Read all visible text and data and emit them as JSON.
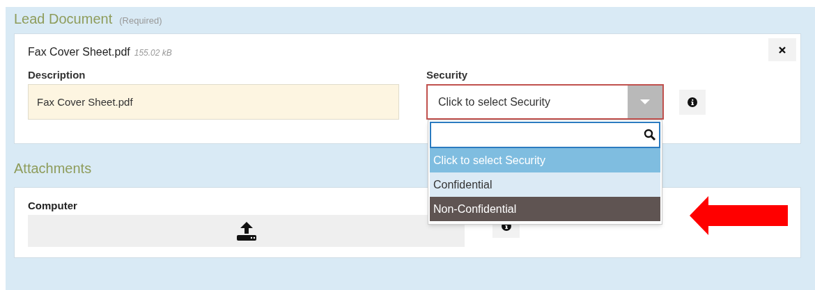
{
  "lead_document": {
    "title": "Lead Document",
    "note": "(Required)",
    "file": {
      "name": "Fax Cover Sheet.pdf",
      "size": "155.02 kB"
    },
    "description": {
      "label": "Description",
      "value": "Fax Cover Sheet.pdf"
    },
    "security": {
      "label": "Security",
      "value": "Click to select Security",
      "options": [
        {
          "label": "Click to select Security",
          "selected": true,
          "hovered": false
        },
        {
          "label": "Confidential",
          "selected": false,
          "hovered": false
        },
        {
          "label": "Non-Confidential",
          "selected": false,
          "hovered": true
        }
      ]
    }
  },
  "attachments": {
    "title": "Attachments",
    "source": {
      "label": "Computer"
    }
  }
}
